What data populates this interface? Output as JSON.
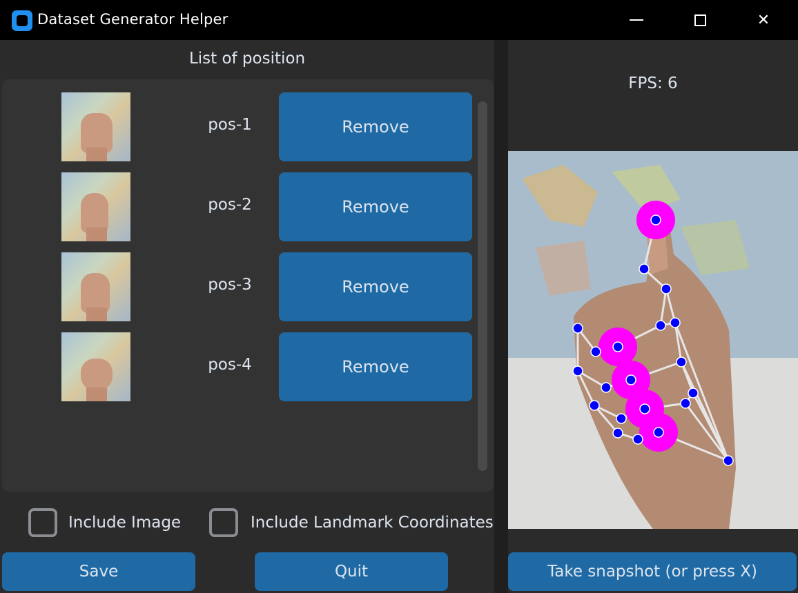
{
  "window": {
    "title": "Dataset Generator Helper",
    "minimize_icon": "minimize-icon",
    "maximize_icon": "maximize-icon",
    "close_icon": "close-icon",
    "close_glyph": "✕"
  },
  "left": {
    "list_title": "List of position",
    "positions": [
      {
        "label": "pos-1",
        "remove_label": "Remove"
      },
      {
        "label": "pos-2",
        "remove_label": "Remove"
      },
      {
        "label": "pos-3",
        "remove_label": "Remove"
      },
      {
        "label": "pos-4",
        "remove_label": "Remove"
      }
    ],
    "options": {
      "include_image_label": "Include Image",
      "include_image_checked": false,
      "include_landmarks_label": "Include Landmark Coordinates",
      "include_landmarks_checked": false
    },
    "save_label": "Save",
    "quit_label": "Quit"
  },
  "right": {
    "fps_text": "FPS: 6",
    "snapshot_label": "Take snapshot (or press X)"
  },
  "colors": {
    "accent": "#1f6aa5",
    "background": "#242424",
    "panel": "#2b2b2b",
    "landmark_point": "#0000ff",
    "landmark_tip": "#ff00ff",
    "landmark_line": "#e6e6e6"
  }
}
